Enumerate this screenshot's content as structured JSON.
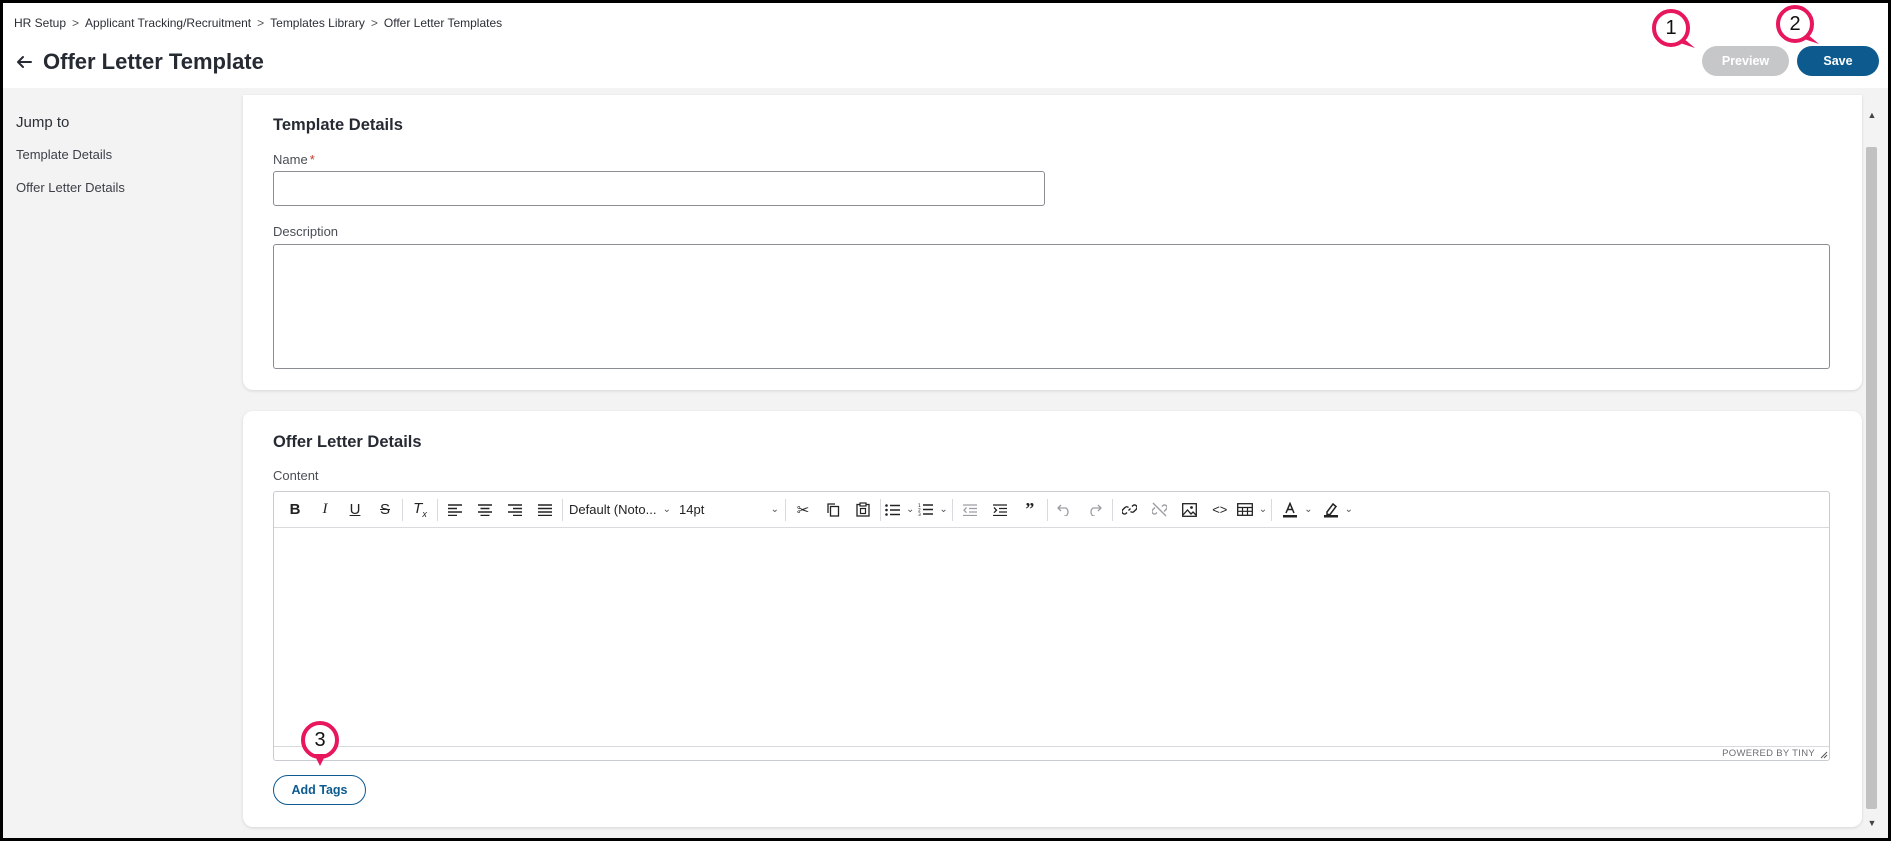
{
  "breadcrumb": [
    "HR Setup",
    "Applicant Tracking/Recruitment",
    "Templates Library",
    "Offer Letter Templates"
  ],
  "breadcrumb_separator": ">",
  "header": {
    "title": "Offer Letter Template",
    "preview_label": "Preview",
    "save_label": "Save"
  },
  "callouts": [
    "1",
    "2",
    "3"
  ],
  "sidebar": {
    "title": "Jump to",
    "items": [
      {
        "label": "Template Details"
      },
      {
        "label": "Offer Letter Details"
      }
    ]
  },
  "template_details": {
    "title": "Template Details",
    "name_label": "Name",
    "required_mark": "*",
    "name_value": "",
    "description_label": "Description",
    "description_value": ""
  },
  "offer_letter_details": {
    "title": "Offer Letter Details",
    "content_label": "Content",
    "font_family": "Default (Noto...",
    "font_size": "14pt",
    "powered_by": "POWERED BY TINY",
    "add_tags_label": "Add Tags"
  },
  "colors": {
    "primary": "#0d5a8f",
    "disabled": "#c6c7c9",
    "callout": "#e8175d"
  }
}
